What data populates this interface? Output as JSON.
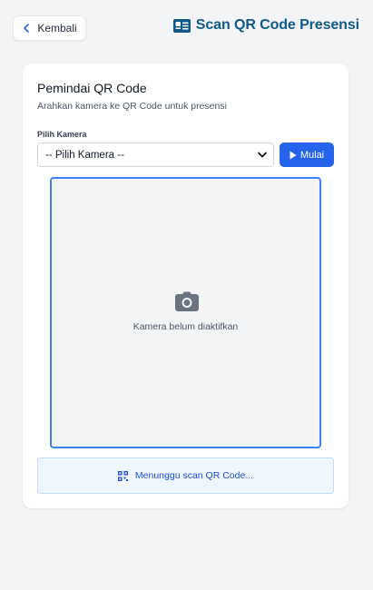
{
  "header": {
    "back_label": "Kembali",
    "title": "Scan QR Code Presensi"
  },
  "scanner": {
    "title": "Pemindai QR Code",
    "subtitle": "Arahkan kamera ke QR Code untuk presensi",
    "camera_label": "Pilih Kamera",
    "camera_selected": "-- Pilih Kamera --",
    "start_label": "Mulai",
    "camera_inactive_text": "Kamera belum diaktifkan",
    "status_text": "Menunggu scan QR Code..."
  },
  "colors": {
    "primary": "#2563eb",
    "title": "#0f5a8a",
    "viewport_border": "#3b82f6",
    "status_bg": "#eff6ff"
  },
  "icons": {
    "back": "chevron-left-icon",
    "title": "id-card-icon",
    "select": "chevron-down-icon",
    "start": "play-icon",
    "camera": "camera-icon",
    "status": "qr-code-icon"
  }
}
